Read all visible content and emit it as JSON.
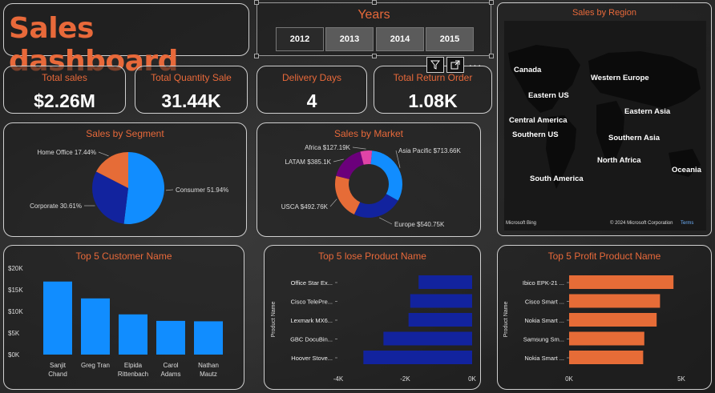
{
  "header": {
    "title": "Sales dashboard"
  },
  "years": {
    "label": "Years",
    "options": [
      "2012",
      "2013",
      "2014",
      "2015"
    ]
  },
  "kpis": [
    {
      "label": "Total sales",
      "value": "$2.26M"
    },
    {
      "label": "Total Quantity Sale",
      "value": "31.44K"
    },
    {
      "label": "Delivery Days",
      "value": "4"
    },
    {
      "label": "Total Return Order",
      "value": "1.08K"
    }
  ],
  "toolbar": {
    "filter_icon": "filter-icon",
    "focus_icon": "focus-mode-icon",
    "more_icon": "more-options-icon",
    "more_label": "···"
  },
  "segment": {
    "title": "Sales by Segment",
    "colors": {
      "consumer": "#118dff",
      "corporate": "#12239e",
      "home_office": "#e66c37"
    }
  },
  "market": {
    "title": "Sales by Market",
    "colors": {
      "asia_pacific": "#118dff",
      "europe": "#12239e",
      "usca": "#e66c37",
      "latam": "#6b007b",
      "africa": "#e044a7"
    }
  },
  "region_map": {
    "title": "Sales by Region",
    "labels": [
      "Canada",
      "Western Europe",
      "Eastern US",
      "Eastern Asia",
      "Central America",
      "Southern US",
      "Southern Asia",
      "North Africa",
      "Oceania",
      "South America"
    ],
    "brand": "Microsoft Bing",
    "copyright": "© 2024 Microsoft Corporation",
    "terms": "Terms"
  },
  "chart_data": [
    {
      "type": "pie",
      "title": "Sales by Segment",
      "labels": [
        "Consumer 51.94%",
        "Corporate 30.61%",
        "Home Office 17.44%"
      ],
      "categories": [
        "Consumer",
        "Corporate",
        "Home Office"
      ],
      "values": [
        51.94,
        30.61,
        17.44
      ]
    },
    {
      "type": "pie",
      "title": "Sales by Market",
      "labels": [
        "Asia Pacific $713.66K",
        "Europe $540.75K",
        "USCA $492.76K",
        "LATAM $385.1K",
        "Africa $127.19K"
      ],
      "categories": [
        "Asia Pacific",
        "Europe",
        "USCA",
        "LATAM",
        "Africa"
      ],
      "values": [
        713.66,
        540.75,
        492.76,
        385.1,
        127.19
      ]
    },
    {
      "type": "bar",
      "title": "Top 5 Customer Name",
      "categories": [
        "Sanjit Chand",
        "Greg Tran",
        "Elpida Rittenbach",
        "Carol Adams",
        "Nathan Mautz"
      ],
      "category_lines": [
        [
          "Sanjit",
          "Chand"
        ],
        [
          "Greg Tran"
        ],
        [
          "Elpida",
          "Rittenbach"
        ],
        [
          "Carol",
          "Adams"
        ],
        [
          "Nathan",
          "Mautz"
        ]
      ],
      "values": [
        16900,
        13000,
        9300,
        7800,
        7700
      ],
      "yticks": [
        "$0K",
        "$5K",
        "$10K",
        "$15K",
        "$20K"
      ],
      "ylim": [
        0,
        20000
      ],
      "color": "#118dff"
    },
    {
      "type": "bar",
      "title": "Top 5 lose Product Name",
      "ylabel": "Product Name",
      "categories": [
        "Office Star Ex...",
        "Cisco TelePre...",
        "Lexmark MX6...",
        "GBC DocuBin...",
        "Hoover Stove..."
      ],
      "values": [
        -1600,
        -1850,
        -1900,
        -2650,
        -3250
      ],
      "xticks": [
        "-4K",
        "-2K",
        "0K"
      ],
      "xlim": [
        -4000,
        0
      ],
      "color": "#12239e"
    },
    {
      "type": "bar",
      "title": "Top 5 Profit Product Name",
      "ylabel": "Product Name",
      "categories": [
        "Ibico EPK-21 ...",
        "Cisco Smart ...",
        "Nokia Smart ...",
        "Samsung Sm...",
        "Nokia Smart ..."
      ],
      "values": [
        4650,
        4050,
        3900,
        3350,
        3300
      ],
      "xticks": [
        "0K",
        "5K"
      ],
      "xlim": [
        0,
        5000
      ],
      "color": "#e66c37"
    }
  ]
}
